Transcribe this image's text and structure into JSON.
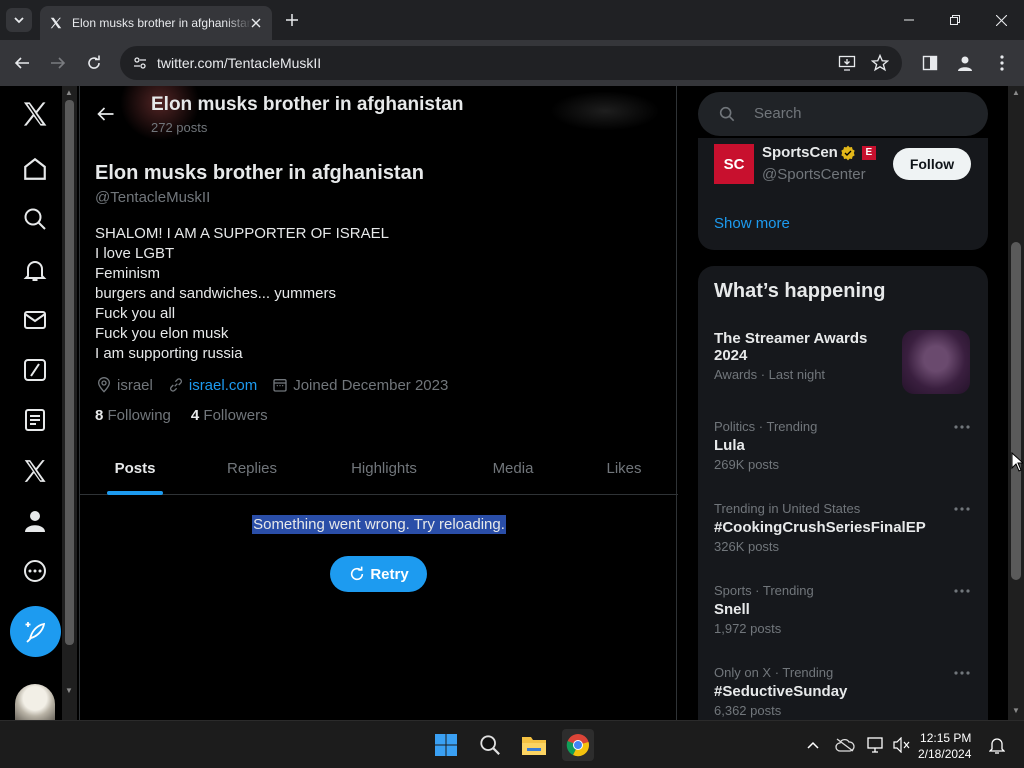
{
  "browser": {
    "tab_title": "Elon musks brother in afghanistan / X",
    "url": "twitter.com/TentacleMuskII"
  },
  "header": {
    "title": "Elon musks brother in afghanistan",
    "post_count": "272 posts"
  },
  "profile": {
    "name": "Elon musks brother in afghanistan",
    "handle": "@TentacleMuskII",
    "bio": [
      "SHALOM! I AM A SUPPORTER OF ISRAEL",
      "I love LGBT",
      "Feminism",
      "burgers and sandwiches... yummers",
      "Fuck you all",
      "Fuck you elon musk",
      "I am supporting russia"
    ],
    "location": "israel",
    "website": "israel.com",
    "joined": "Joined December 2023",
    "following_count": "8",
    "following_label": "Following",
    "followers_count": "4",
    "followers_label": "Followers"
  },
  "tabs": [
    "Posts",
    "Replies",
    "Highlights",
    "Media",
    "Likes"
  ],
  "error": {
    "message": "Something went wrong. Try reloading.",
    "retry_label": "Retry"
  },
  "sidebar": {
    "search_placeholder": "Search",
    "suggestion": {
      "name": "SportsCen",
      "handle": "@SportsCenter",
      "logo": "SC",
      "follow_label": "Follow"
    },
    "show_more": "Show more",
    "whats_happening": "What’s happening",
    "trends": [
      {
        "context": "",
        "name": "The Streamer Awards 2024",
        "count": "Awards · Last night"
      },
      {
        "context": "Politics · Trending",
        "name": "Lula",
        "count": "269K posts"
      },
      {
        "context": "Trending in United States",
        "name": "#CookingCrushSeriesFinalEP",
        "count": "326K posts"
      },
      {
        "context": "Sports · Trending",
        "name": "Snell",
        "count": "1,972 posts"
      },
      {
        "context": "Only on X · Trending",
        "name": "#SeductiveSunday",
        "count": "6,362 posts"
      }
    ]
  },
  "taskbar": {
    "time": "12:15 PM",
    "date": "2/18/2024"
  },
  "colors": {
    "accent": "#1d9bf0",
    "background": "#000000",
    "selection": "#2a4ea8"
  }
}
